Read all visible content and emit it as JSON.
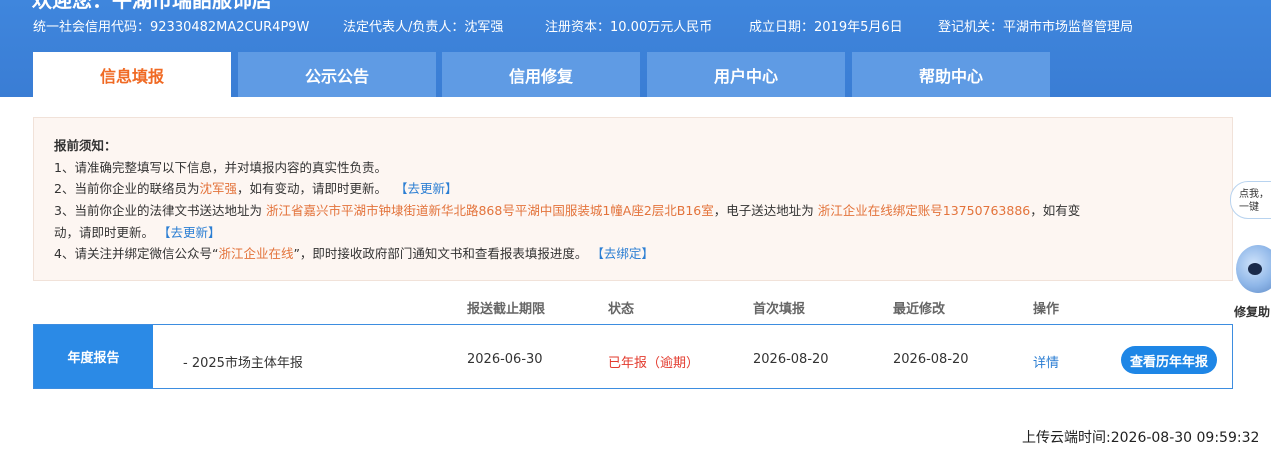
{
  "header": {
    "welcome": "欢迎您：平湖市瑞韶服饰店",
    "credit_code": "统一社会信用代码：92330482MA2CUR4P9W",
    "legal_rep": "法定代表人/负责人：沈军强",
    "capital": "注册资本：10.00万元人民币",
    "established": "成立日期：2019年5月6日",
    "authority": "登记机关：平湖市市场监督管理局"
  },
  "tabs": [
    {
      "label": "信息填报",
      "active": true
    },
    {
      "label": "公示公告",
      "active": false
    },
    {
      "label": "信用修复",
      "active": false
    },
    {
      "label": "用户中心",
      "active": false
    },
    {
      "label": "帮助中心",
      "active": false
    }
  ],
  "notice": {
    "title": "报前须知：",
    "item1": "1、请准确完整填写以下信息，并对填报内容的真实性负责。",
    "item2_pre": "2、当前你企业的联络员为",
    "item2_name": "沈军强",
    "item2_post": "，如有变动，请即时更新。",
    "item2_link": "【去更新】",
    "item3_pre": "3、当前你企业的法律文书送达地址为",
    "item3_addr": "浙江省嘉兴市平湖市钟埭街道新华北路868号平湖中国服装城1幢A座2层北B16室",
    "item3_mid": "，电子送达地址为",
    "item3_eaddr": "浙江企业在线绑定账号13750763886",
    "item3_post": "，如有变",
    "item3_cont": "动，请即时更新。",
    "item3_link": "【去更新】",
    "item4_pre": "4、请关注并绑定微信公众号“",
    "item4_name": "浙江企业在线",
    "item4_post": "”，即时接收政府部门通知文书和查看报表填报进度。",
    "item4_link": "【去绑定】"
  },
  "table": {
    "headers": {
      "deadline": "报送截止期限",
      "status": "状态",
      "first": "首次填报",
      "modified": "最近修改",
      "action": "操作"
    },
    "row": {
      "label": "年度报告",
      "name": "- 2025市场主体年报",
      "deadline": "2026-06-30",
      "status": "已年报（逾期）",
      "first": "2026-08-20",
      "modified": "2026-08-20",
      "detail": "详情",
      "history_button": "查看历年年报"
    }
  },
  "upload_time": "上传云端时间:2026-08-30 09:59:32",
  "assistant": {
    "bubble_line1": "点我，",
    "bubble_line2": "一键",
    "label": "修复助"
  },
  "colors": {
    "header_bg": "#3a7dd4",
    "tab_bg": "#5f9be4",
    "active_tab_text": "#f06a24",
    "highlight": "#e3733b",
    "link": "#2b7ed3",
    "status_red": "#e33b2e",
    "primary_button": "#1e86e6"
  }
}
